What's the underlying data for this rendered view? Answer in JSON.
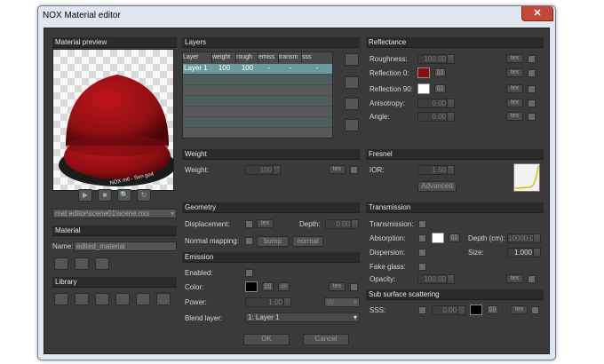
{
  "window": {
    "title": "NOX Material editor",
    "close_glyph": "✕"
  },
  "preview": {
    "header": "Material preview",
    "overlay_text": "NOX mtl - Son go4",
    "colors": {
      "material": "#8d0f14"
    }
  },
  "preview_controls": {
    "play": "▶",
    "stop": "■",
    "zoom": "🔍",
    "refresh": "↻"
  },
  "path": {
    "value": "mat editor\\scene01\\scene.nxs"
  },
  "material": {
    "header": "Material",
    "name_label": "Name:",
    "name_value": "edited_material"
  },
  "library": {
    "header": "Library"
  },
  "layers": {
    "header": "Layers",
    "columns": [
      "Layer",
      "weight",
      "rough",
      "emiss",
      "transm",
      "sss"
    ],
    "rows": [
      {
        "layer": "Layer 1",
        "weight": "100",
        "rough": "100",
        "emiss": "-",
        "transm": "-",
        "sss": "-"
      }
    ]
  },
  "weight": {
    "header": "Weight",
    "label": "Weight:",
    "value": "100",
    "tex": "tex"
  },
  "geometry": {
    "header": "Geometry",
    "displacement_label": "Displacement:",
    "tex": "tex",
    "depth_label": "Depth:",
    "depth_value": "0.00",
    "normal_label": "Normal mapping:",
    "bump": "bump",
    "normal": "normal"
  },
  "emission": {
    "header": "Emission",
    "enabled_label": "Enabled:",
    "color_label": "Color:",
    "tex": "tex",
    "power_label": "Power:",
    "power_value": "1.00",
    "power_unit": "W",
    "blend_label": "Blend layer:",
    "blend_value": "1: Layer 1"
  },
  "reflectance": {
    "header": "Reflectance",
    "roughness_label": "Roughness:",
    "roughness_value": "100.00",
    "refl0_label": "Reflection 0:",
    "refl90_label": "Reflection 90:",
    "aniso_label": "Anisotropy:",
    "aniso_value": "0.00",
    "angle_label": "Angle:",
    "angle_value": "0.00",
    "tex": "tex",
    "colors": {
      "refl0": "#8c0d10",
      "refl90": "#ffffff"
    }
  },
  "fresnel": {
    "header": "Fresnel",
    "ior_label": "IOR:",
    "ior_value": "1.60",
    "advanced": "Advanced"
  },
  "transmission": {
    "header": "Transmission",
    "transmission_label": "Transmission:",
    "absorption_label": "Absorption:",
    "depth_label": "Depth (cm):",
    "depth_value": "10000.0",
    "dispersion_label": "Dispersion:",
    "size_label": "Size:",
    "size_value": "1.000",
    "fake_glass_label": "Fake glass:",
    "opacity_label": "Opacity:",
    "opacity_value": "100.00",
    "tex": "tex",
    "colors": {
      "absorption": "#ffffff"
    }
  },
  "sss": {
    "header": "Sub surface scattering",
    "label": "SSS:",
    "value": "0.00",
    "tex": "tex",
    "colors": {
      "sss": "#000000"
    }
  },
  "footer": {
    "ok": "OK",
    "cancel": "Cancel"
  }
}
